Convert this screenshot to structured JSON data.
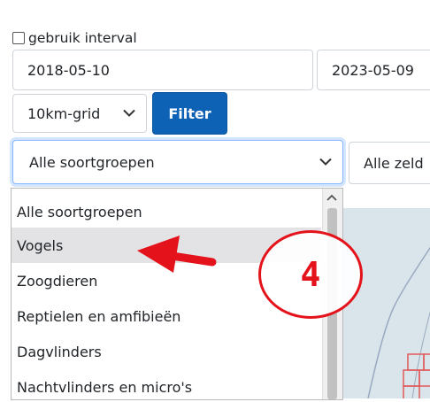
{
  "interval": {
    "label": "gebruik interval",
    "checked": false
  },
  "dates": {
    "from": "2018-05-10",
    "to": "2023-05-09"
  },
  "grid_select": {
    "value": "10km-grid"
  },
  "filter_button": {
    "label": "Filter"
  },
  "group_select": {
    "value": "Alle soortgroepen"
  },
  "rarity_select": {
    "value": "Alle zeld"
  },
  "dropdown": {
    "items": [
      {
        "label": "Alle soortgroepen"
      },
      {
        "label": "Vogels"
      },
      {
        "label": "Zoogdieren"
      },
      {
        "label": "Reptielen en amfibieën"
      },
      {
        "label": "Dagvlinders"
      },
      {
        "label": "Nachtvlinders en micro's"
      }
    ],
    "selected_index": 1
  },
  "annotation": {
    "step_number": "4",
    "color": "#e4131b"
  },
  "colors": {
    "accent": "#0d62b5",
    "annotation": "#e4131b",
    "selected_row": "#e3e3e6",
    "map_water": "#d9e5ea"
  }
}
